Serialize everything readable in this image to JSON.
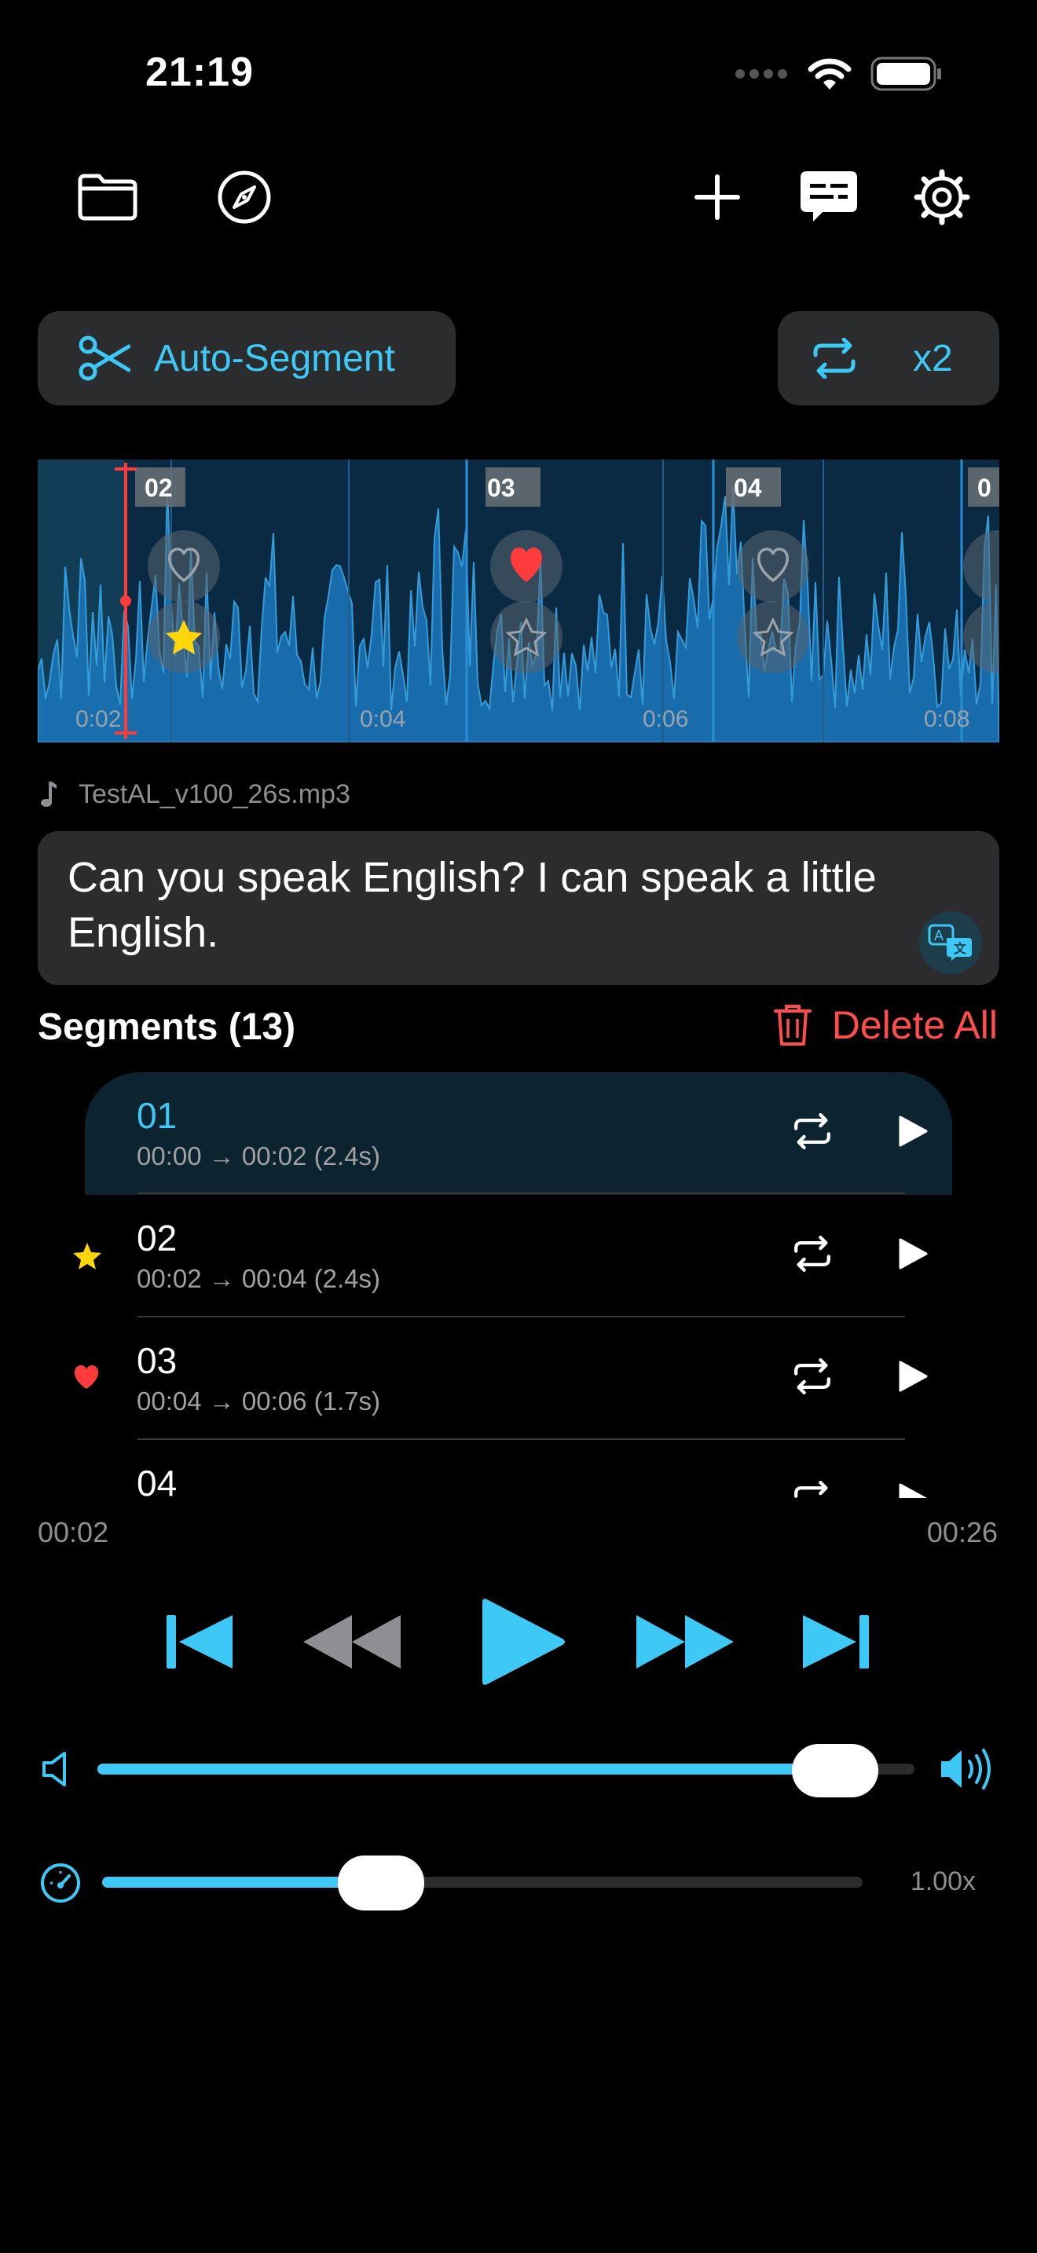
{
  "status": {
    "time": "21:19"
  },
  "toolbar": {
    "left": [
      "folder-icon",
      "compass-icon"
    ],
    "right": [
      "plus-icon",
      "subtitles-icon",
      "settings-icon"
    ]
  },
  "actions": {
    "auto_segment_label": "Auto-Segment",
    "repeat_label": "x2"
  },
  "waveform": {
    "segment_labels": [
      "02",
      "03",
      "04",
      "0"
    ],
    "time_labels": [
      "0:02",
      "0:04",
      "0:06",
      "0:08"
    ],
    "favorites": {
      "02": "star",
      "03": "heart"
    }
  },
  "file": {
    "name": "TestAL_v100_26s.mp3"
  },
  "transcript": {
    "text": "Can you speak English?  I can speak a little English."
  },
  "segments": {
    "header": "Segments (13)",
    "delete_all_label": "Delete All",
    "items": [
      {
        "title": "01",
        "range": "00:00 → 00:02 (2.4s)",
        "mark": "",
        "active": true
      },
      {
        "title": "02",
        "range": "00:02 → 00:04 (2.4s)",
        "mark": "star",
        "active": false
      },
      {
        "title": "03",
        "range": "00:04 → 00:06 (1.7s)",
        "mark": "heart",
        "active": false
      },
      {
        "title": "04",
        "range": "",
        "mark": "",
        "active": false
      }
    ]
  },
  "playback": {
    "current_time": "00:02",
    "total_time": "00:26",
    "volume": 0.95,
    "speed_level": 0.35,
    "speed_label": "1.00x"
  },
  "colors": {
    "accent": "#3ec8f5",
    "danger": "#ff4d4d",
    "star": "#ffd60a",
    "heart": "#ff3b3b"
  }
}
